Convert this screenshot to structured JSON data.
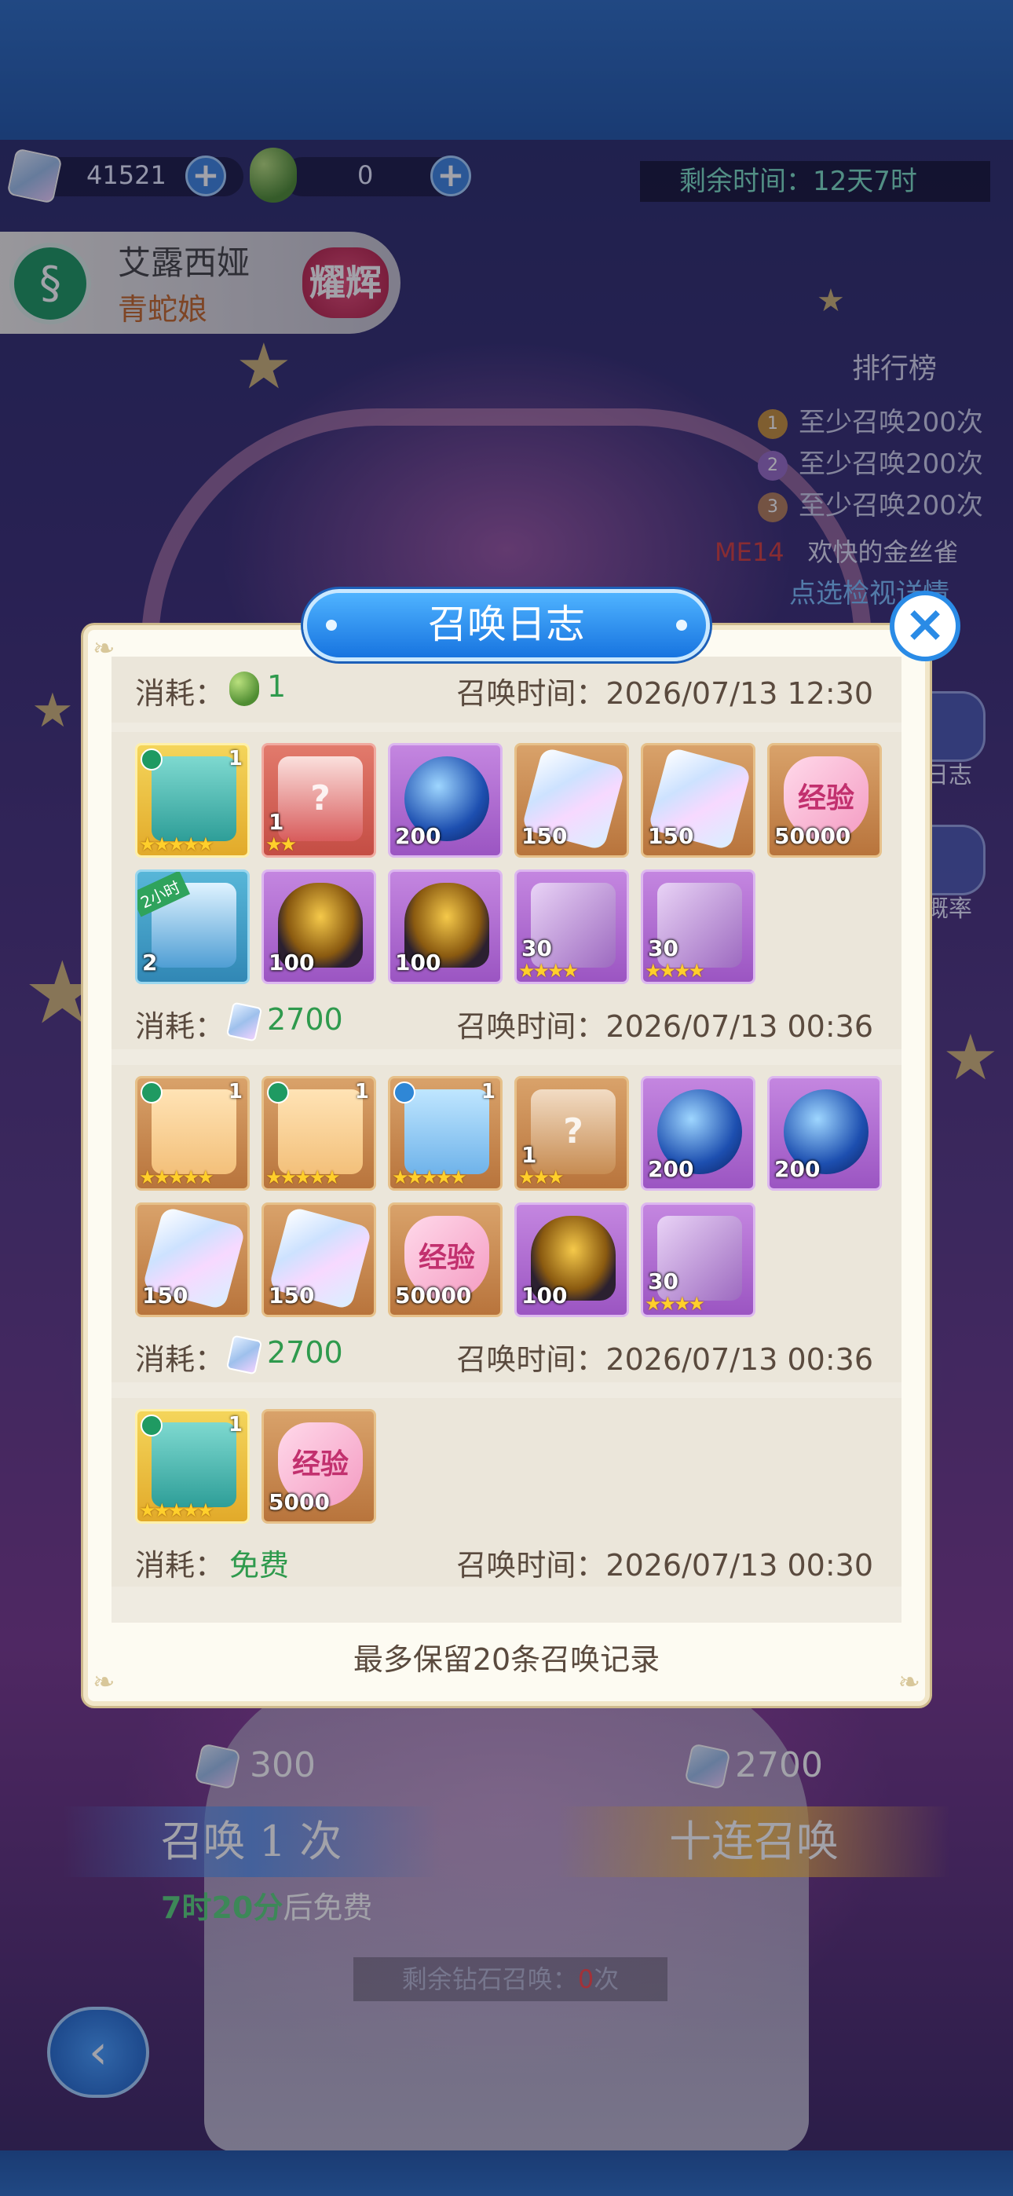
{
  "currency": {
    "diamonds": "41521",
    "grapes": "0"
  },
  "timer": "剩余时间：12天7时",
  "character": {
    "name": "艾露西娅",
    "subtitle": "青蛇娘",
    "badge": "耀辉"
  },
  "ranking": {
    "title": "排行榜",
    "rows": [
      {
        "rank": "1",
        "text": "至少召唤200次"
      },
      {
        "rank": "2",
        "text": "至少召唤200次"
      },
      {
        "rank": "3",
        "text": "至少召唤200次"
      }
    ],
    "me_label": "ME14",
    "me_name": "欢快的金丝雀",
    "link": "点选检视详情"
  },
  "side_buttons": [
    "日志",
    "概率"
  ],
  "summon": {
    "single_cost": "300",
    "ten_cost": "2700",
    "single_label": "召唤 1 次",
    "ten_label": "十连召唤",
    "free_hint_time": "7时20分",
    "free_hint_suffix": "后免费",
    "remain_prefix": "剩余钻石召唤：",
    "remain_count": "0",
    "remain_suffix": "次"
  },
  "dialog": {
    "title": "召唤日志",
    "close_icon": "close-icon",
    "cost_label": "消耗：",
    "time_label": "召唤时间：",
    "entries": [
      {
        "cost": "1",
        "cost_icon": "grape-icon",
        "time": "2026/07/13 12:30",
        "items": []
      },
      {
        "cost": "2700",
        "cost_icon": "diamond-icon",
        "time": "2026/07/13 00:36",
        "items": [
          {
            "type": "hero-green",
            "qty": "1",
            "stars": "★★★★★"
          },
          {
            "type": "gift-box",
            "qty": "1",
            "stars": "★★"
          },
          {
            "type": "orb",
            "qty": "200"
          },
          {
            "type": "crystal",
            "qty": "150"
          },
          {
            "type": "crystal",
            "qty": "150"
          },
          {
            "type": "exp",
            "qty": "50000",
            "text": "经验"
          },
          {
            "type": "chest",
            "qty": "2",
            "badge": "2小时"
          },
          {
            "type": "egg",
            "qty": "100"
          },
          {
            "type": "egg",
            "qty": "100"
          },
          {
            "type": "cube",
            "qty": "30",
            "stars": "★★★★"
          },
          {
            "type": "cube",
            "qty": "30",
            "stars": "★★★★"
          }
        ]
      },
      {
        "cost": "2700",
        "cost_icon": "diamond-icon",
        "time": "2026/07/13 00:36",
        "items": [
          {
            "type": "hero-blonde",
            "qty": "1",
            "stars": "★★★★★"
          },
          {
            "type": "hero-blonde",
            "qty": "1",
            "stars": "★★★★★"
          },
          {
            "type": "hero-blue",
            "qty": "1",
            "stars": "★★★★★"
          },
          {
            "type": "gift-box-orange",
            "qty": "1",
            "stars": "★★★"
          },
          {
            "type": "orb",
            "qty": "200"
          },
          {
            "type": "orb",
            "qty": "200"
          },
          {
            "type": "crystal",
            "qty": "150"
          },
          {
            "type": "crystal",
            "qty": "150"
          },
          {
            "type": "exp",
            "qty": "50000",
            "text": "经验"
          },
          {
            "type": "egg",
            "qty": "100"
          },
          {
            "type": "cube",
            "qty": "30",
            "stars": "★★★★"
          }
        ]
      },
      {
        "cost": "免费",
        "cost_icon": "",
        "time": "2026/07/13 00:30",
        "items": [
          {
            "type": "hero-green",
            "qty": "1",
            "stars": "★★★★★"
          },
          {
            "type": "exp",
            "qty": "5000",
            "text": "经验"
          }
        ]
      }
    ],
    "footer": "最多保留20条召唤记录"
  },
  "colors": {
    "accent_blue": "#1774e0",
    "cost_green": "#2f9a4d",
    "dialog_bg": "#fdfbf2",
    "entry_bg": "#ebe6da"
  }
}
